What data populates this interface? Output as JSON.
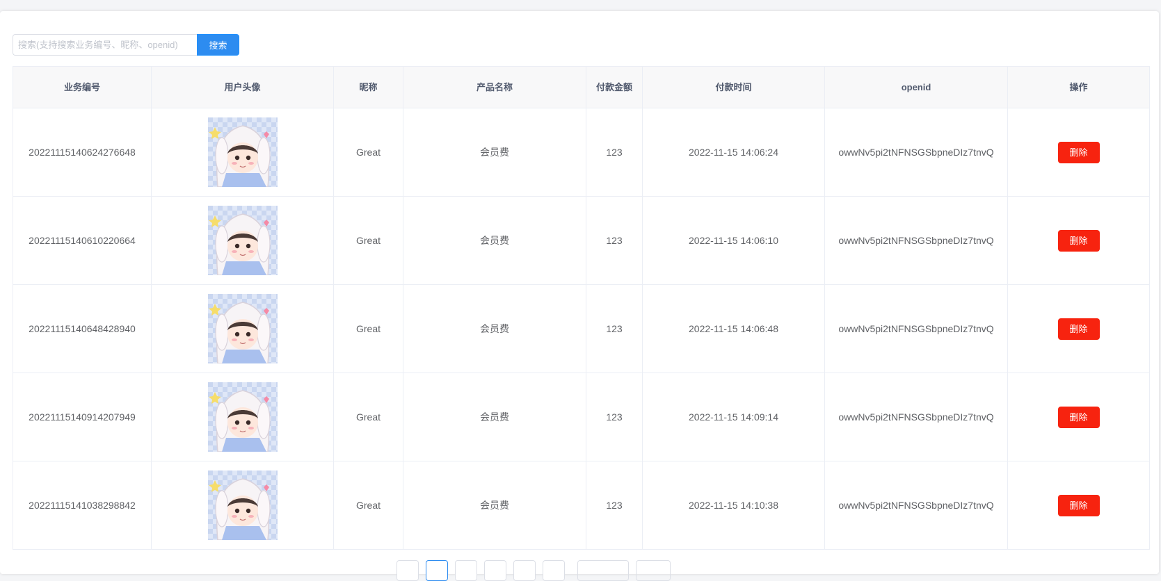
{
  "search": {
    "placeholder": "搜索(支持搜索业务编号、昵称、openid)",
    "value": "",
    "button_label": "搜索"
  },
  "table": {
    "headers": {
      "business_no": "业务编号",
      "avatar": "用户头像",
      "nickname": "昵称",
      "product": "产品名称",
      "amount": "付款金额",
      "paid_time": "付款时间",
      "openid": "openid",
      "action": "操作"
    },
    "rows": [
      {
        "business_no": "20221115140624276648",
        "nickname": "Great",
        "product": "会员费",
        "amount": "123",
        "paid_time": "2022-11-15 14:06:24",
        "openid": "owwNv5pi2tNFNSGSbpneDIz7tnvQ",
        "action_label": "删除"
      },
      {
        "business_no": "20221115140610220664",
        "nickname": "Great",
        "product": "会员费",
        "amount": "123",
        "paid_time": "2022-11-15 14:06:10",
        "openid": "owwNv5pi2tNFNSGSbpneDIz7tnvQ",
        "action_label": "删除"
      },
      {
        "business_no": "20221115140648428940",
        "nickname": "Great",
        "product": "会员费",
        "amount": "123",
        "paid_time": "2022-11-15 14:06:48",
        "openid": "owwNv5pi2tNFNSGSbpneDIz7tnvQ",
        "action_label": "删除"
      },
      {
        "business_no": "20221115140914207949",
        "nickname": "Great",
        "product": "会员费",
        "amount": "123",
        "paid_time": "2022-11-15 14:09:14",
        "openid": "owwNv5pi2tNFNSGSbpneDIz7tnvQ",
        "action_label": "删除"
      },
      {
        "business_no": "20221115141038298842",
        "nickname": "Great",
        "product": "会员费",
        "amount": "123",
        "paid_time": "2022-11-15 14:10:38",
        "openid": "owwNv5pi2tNFNSGSbpneDIz7tnvQ",
        "action_label": "删除"
      }
    ]
  },
  "colors": {
    "primary": "#2d8cf0",
    "danger": "#f7230f",
    "header_bg": "#f8f8f9",
    "border": "#ebeef5"
  },
  "icons": {
    "avatar": "avatar-image"
  }
}
